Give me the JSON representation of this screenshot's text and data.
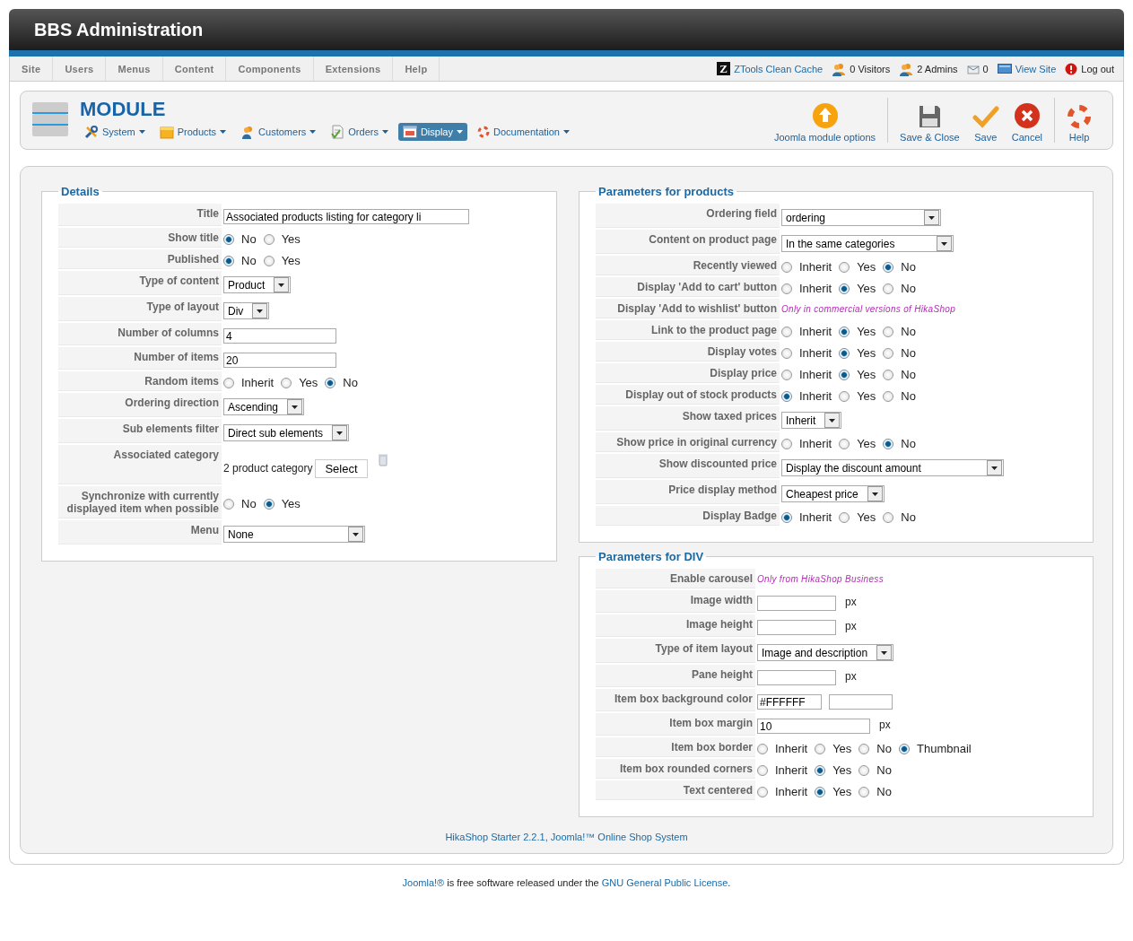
{
  "header": {
    "title": "BBS Administration"
  },
  "menu": [
    {
      "label": "Site"
    },
    {
      "label": "Users"
    },
    {
      "label": "Menus"
    },
    {
      "label": "Content"
    },
    {
      "label": "Components"
    },
    {
      "label": "Extensions"
    },
    {
      "label": "Help"
    }
  ],
  "status": [
    {
      "kind": "link",
      "label": "ZTools Clean Cache",
      "icon_text": "Z"
    },
    {
      "kind": "text",
      "label": "0 Visitors"
    },
    {
      "kind": "text",
      "label": "2 Admins"
    },
    {
      "kind": "text",
      "label": "0"
    },
    {
      "kind": "link",
      "label": "View Site"
    },
    {
      "kind": "text",
      "label": "Log out"
    }
  ],
  "toolbar": {
    "title": "MODULE",
    "submenu": [
      {
        "label": "System",
        "selected": false
      },
      {
        "label": "Products",
        "selected": false
      },
      {
        "label": "Customers",
        "selected": false
      },
      {
        "label": "Orders",
        "selected": false
      },
      {
        "label": "Display",
        "selected": true
      },
      {
        "label": "Documentation",
        "selected": false
      }
    ],
    "action_groups": [
      {
        "actions": [
          {
            "label": "Joomla module options"
          }
        ]
      },
      {
        "actions": [
          {
            "label": "Save & Close"
          },
          {
            "label": "Save"
          },
          {
            "label": "Cancel"
          }
        ]
      },
      {
        "actions": [
          {
            "label": "Help"
          }
        ]
      }
    ]
  },
  "details": {
    "legend": "Details",
    "rows": [
      {
        "label": "Title",
        "kind": "text",
        "value": "Associated products listing for category li"
      },
      {
        "label": "Show title",
        "kind": "radio",
        "options": [
          {
            "label": "No",
            "selected": true
          },
          {
            "label": "Yes",
            "selected": false
          }
        ]
      },
      {
        "label": "Published",
        "kind": "radio",
        "options": [
          {
            "label": "No",
            "selected": true
          },
          {
            "label": "Yes",
            "selected": false
          }
        ]
      },
      {
        "label": "Type of content",
        "kind": "select",
        "value": "Product"
      },
      {
        "label": "Type of layout",
        "kind": "select",
        "value": "Div"
      },
      {
        "label": "Number of columns",
        "kind": "text",
        "value": "4"
      },
      {
        "label": "Number of items",
        "kind": "text",
        "value": "20"
      },
      {
        "label": "Random items",
        "kind": "radio",
        "options": [
          {
            "label": "Inherit",
            "selected": false
          },
          {
            "label": "Yes",
            "selected": false
          },
          {
            "label": "No",
            "selected": true
          }
        ]
      },
      {
        "label": "Ordering direction",
        "kind": "select",
        "value": "Ascending"
      },
      {
        "label": "Sub elements filter",
        "kind": "select",
        "value": "Direct sub elements"
      },
      {
        "label": "Associated category",
        "kind": "category",
        "value": "2 product category",
        "button": "Select"
      },
      {
        "label": "Synchronize with currently displayed item when possible",
        "kind": "radio",
        "options": [
          {
            "label": "No",
            "selected": false
          },
          {
            "label": "Yes",
            "selected": true
          }
        ]
      },
      {
        "label": "Menu",
        "kind": "select",
        "value": "None"
      }
    ]
  },
  "product_parameters": {
    "legend": "Parameters for products",
    "rows": [
      {
        "label": "Ordering field",
        "kind": "select",
        "value": "ordering"
      },
      {
        "label": "Content on product page",
        "kind": "select",
        "value": "In the same categories"
      },
      {
        "label": "Recently viewed",
        "kind": "radio",
        "options": [
          {
            "label": "Inherit",
            "selected": false
          },
          {
            "label": "Yes",
            "selected": false
          },
          {
            "label": "No",
            "selected": true
          }
        ]
      },
      {
        "label": "Display 'Add to cart' button",
        "kind": "radio",
        "options": [
          {
            "label": "Inherit",
            "selected": false
          },
          {
            "label": "Yes",
            "selected": true
          },
          {
            "label": "No",
            "selected": false
          }
        ]
      },
      {
        "label": "Display 'Add to wishlist' button",
        "kind": "note",
        "value": "Only in commercial versions of HikaShop"
      },
      {
        "label": "Link to the product page",
        "kind": "radio",
        "options": [
          {
            "label": "Inherit",
            "selected": false
          },
          {
            "label": "Yes",
            "selected": true
          },
          {
            "label": "No",
            "selected": false
          }
        ]
      },
      {
        "label": "Display votes",
        "kind": "radio",
        "options": [
          {
            "label": "Inherit",
            "selected": false
          },
          {
            "label": "Yes",
            "selected": true
          },
          {
            "label": "No",
            "selected": false
          }
        ]
      },
      {
        "label": "Display price",
        "kind": "radio",
        "options": [
          {
            "label": "Inherit",
            "selected": false
          },
          {
            "label": "Yes",
            "selected": true
          },
          {
            "label": "No",
            "selected": false
          }
        ]
      },
      {
        "label": "Display out of stock products",
        "kind": "radio",
        "options": [
          {
            "label": "Inherit",
            "selected": true
          },
          {
            "label": "Yes",
            "selected": false
          },
          {
            "label": "No",
            "selected": false
          }
        ]
      },
      {
        "label": "Show taxed prices",
        "kind": "select",
        "value": "Inherit"
      },
      {
        "label": "Show price in original currency",
        "kind": "radio",
        "options": [
          {
            "label": "Inherit",
            "selected": false
          },
          {
            "label": "Yes",
            "selected": false
          },
          {
            "label": "No",
            "selected": true
          }
        ]
      },
      {
        "label": "Show discounted price",
        "kind": "select",
        "value": "Display the discount amount"
      },
      {
        "label": "Price display method",
        "kind": "select",
        "value": "Cheapest price"
      },
      {
        "label": "Display Badge",
        "kind": "radio",
        "options": [
          {
            "label": "Inherit",
            "selected": true
          },
          {
            "label": "Yes",
            "selected": false
          },
          {
            "label": "No",
            "selected": false
          }
        ]
      }
    ]
  },
  "div_parameters": {
    "legend": "Parameters for DIV",
    "rows": [
      {
        "label": "Enable carousel",
        "kind": "note",
        "value": "Only from HikaShop Business"
      },
      {
        "label": "Image width",
        "kind": "text",
        "unit": "px"
      },
      {
        "label": "Image height",
        "kind": "text",
        "unit": "px"
      },
      {
        "label": "Type of item layout",
        "kind": "select",
        "value": "Image and description"
      },
      {
        "label": "Pane height",
        "kind": "text",
        "unit": "px"
      },
      {
        "label": "Item box background color",
        "kind": "color",
        "value": "#FFFFFF"
      },
      {
        "label": "Item box margin",
        "kind": "text",
        "value": "10",
        "unit": "px"
      },
      {
        "label": "Item box border",
        "kind": "radio",
        "options": [
          {
            "label": "Inherit",
            "selected": false
          },
          {
            "label": "Yes",
            "selected": false
          },
          {
            "label": "No",
            "selected": false
          },
          {
            "label": "Thumbnail",
            "selected": true
          }
        ]
      },
      {
        "label": "Item box rounded corners",
        "kind": "radio",
        "options": [
          {
            "label": "Inherit",
            "selected": false
          },
          {
            "label": "Yes",
            "selected": true
          },
          {
            "label": "No",
            "selected": false
          }
        ]
      },
      {
        "label": "Text centered",
        "kind": "radio",
        "options": [
          {
            "label": "Inherit",
            "selected": false
          },
          {
            "label": "Yes",
            "selected": true
          },
          {
            "label": "No",
            "selected": false
          }
        ]
      }
    ]
  },
  "credit": "HikaShop Starter 2.2.1, Joomla!™ Online Shop System",
  "license": [
    {
      "text": "Joomla!®",
      "link": true
    },
    {
      "text": " is free software released under the ",
      "link": false
    },
    {
      "text": "GNU General Public License",
      "link": true
    },
    {
      "text": ".",
      "link": false
    }
  ]
}
